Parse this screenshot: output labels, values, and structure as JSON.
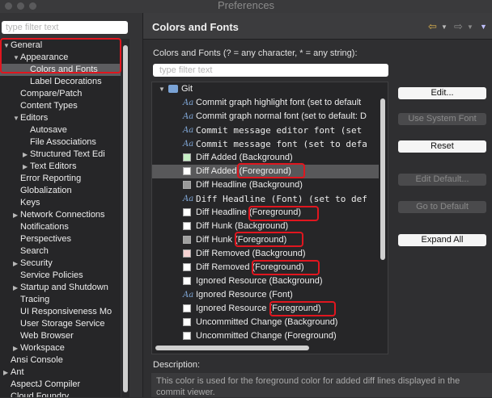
{
  "window": {
    "title": "Preferences"
  },
  "left": {
    "filter_placeholder": "type filter text",
    "tree": [
      {
        "label": "General",
        "level": 0,
        "expanded": true
      },
      {
        "label": "Appearance",
        "level": 1,
        "expanded": true
      },
      {
        "label": "Colors and Fonts",
        "level": 2,
        "selected": true
      },
      {
        "label": "Label Decorations",
        "level": 2
      },
      {
        "label": "Compare/Patch",
        "level": 1
      },
      {
        "label": "Content Types",
        "level": 1
      },
      {
        "label": "Editors",
        "level": 1,
        "expanded": true
      },
      {
        "label": "Autosave",
        "level": 2
      },
      {
        "label": "File Associations",
        "level": 2
      },
      {
        "label": "Structured Text Edi",
        "level": 2,
        "collapsed": true
      },
      {
        "label": "Text Editors",
        "level": 2,
        "collapsed": true
      },
      {
        "label": "Error Reporting",
        "level": 1
      },
      {
        "label": "Globalization",
        "level": 1
      },
      {
        "label": "Keys",
        "level": 1
      },
      {
        "label": "Network Connections",
        "level": 1,
        "collapsed": true
      },
      {
        "label": "Notifications",
        "level": 1
      },
      {
        "label": "Perspectives",
        "level": 1
      },
      {
        "label": "Search",
        "level": 1
      },
      {
        "label": "Security",
        "level": 1,
        "collapsed": true
      },
      {
        "label": "Service Policies",
        "level": 1
      },
      {
        "label": "Startup and Shutdown",
        "level": 1,
        "collapsed": true
      },
      {
        "label": "Tracing",
        "level": 1
      },
      {
        "label": "UI Responsiveness Mo",
        "level": 1
      },
      {
        "label": "User Storage Service",
        "level": 1
      },
      {
        "label": "Web Browser",
        "level": 1
      },
      {
        "label": "Workspace",
        "level": 1,
        "collapsed": true
      },
      {
        "label": "Ansi Console",
        "level": 0
      },
      {
        "label": "Ant",
        "level": 0,
        "collapsed": true
      },
      {
        "label": "AspectJ Compiler",
        "level": 0
      },
      {
        "label": "Cloud Foundry",
        "level": 0
      }
    ]
  },
  "main": {
    "title": "Colors and Fonts",
    "filter_label": "Colors and Fonts (? = any character, * = any string):",
    "filter_placeholder": "type filter text",
    "category": "Git",
    "items": [
      {
        "kind": "font",
        "label": "Commit graph highlight font (set to default",
        "mono": false
      },
      {
        "kind": "font",
        "label": "Commit graph normal font (set to default: D",
        "mono": false
      },
      {
        "kind": "font",
        "label": "Commit message editor font (set",
        "mono": true
      },
      {
        "kind": "font",
        "label": "Commit message font (set to defa",
        "mono": true
      },
      {
        "kind": "color",
        "label": "Diff Added (Background)",
        "swatch": "#c7f0c6"
      },
      {
        "kind": "color",
        "label": "Diff Added (Foreground)",
        "swatch": "#ffffff",
        "selected": true
      },
      {
        "kind": "color",
        "label": "Diff Headline (Background)",
        "swatch": "#9a9a9a"
      },
      {
        "kind": "font",
        "label": "Diff Headline (Font) (set to def",
        "mono": true
      },
      {
        "kind": "color",
        "label": "Diff Headline (Foreground)",
        "swatch": "#ffffff"
      },
      {
        "kind": "color",
        "label": "Diff Hunk (Background)",
        "swatch": "#ffffff"
      },
      {
        "kind": "color",
        "label": "Diff Hunk (Foreground)",
        "swatch": "#a0a0a0"
      },
      {
        "kind": "color",
        "label": "Diff Removed (Background)",
        "swatch": "#f6d2d2"
      },
      {
        "kind": "color",
        "label": "Diff Removed (Foreground)",
        "swatch": "#ffffff"
      },
      {
        "kind": "color",
        "label": "Ignored Resource (Background)",
        "swatch": "#ffffff"
      },
      {
        "kind": "font",
        "label": "Ignored Resource (Font)",
        "mono": false
      },
      {
        "kind": "color",
        "label": "Ignored Resource (Foreground)",
        "swatch": "#ffffff"
      },
      {
        "kind": "color",
        "label": "Uncommitted Change (Background)",
        "swatch": "#ffffff"
      },
      {
        "kind": "color",
        "label": "Uncommitted Change (Foreground)",
        "swatch": "#ffffff"
      }
    ],
    "buttons": {
      "edit": "Edit...",
      "use_system_font": "Use System Font",
      "reset": "Reset",
      "edit_default": "Edit Default...",
      "go_to_default": "Go to Default",
      "expand_all": "Expand All"
    },
    "description_title": "Description:",
    "description_text": "This color is used for the foreground color for added diff lines displayed in the commit viewer."
  },
  "colors": {
    "highlight": "#e0161f",
    "selection": "#5d5d60",
    "nav_arrow": "#d9b04e"
  }
}
